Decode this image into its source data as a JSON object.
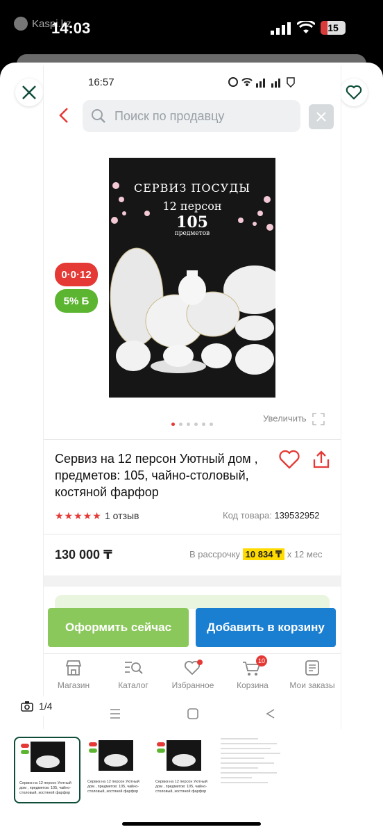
{
  "os_status": {
    "time": "14:03",
    "app_label": "Kaspi.kz",
    "battery": "15"
  },
  "viewer": {
    "counter": "1/4"
  },
  "inner_status": {
    "time": "16:57"
  },
  "header": {
    "search_placeholder": "Поиск по продавцу"
  },
  "poster": {
    "line1": "СЕРВИЗ ПОСУДЫ",
    "line2": "12 персон",
    "line3": "105",
    "line4": "предметов"
  },
  "badges": {
    "installment": "0·0·12",
    "bonus": "5% Б"
  },
  "gallery": {
    "zoom_label": "Увеличить"
  },
  "product": {
    "title": "Сервиз на 12 персон Уютный дом , предметов: 105, чайно-столовый, костяной фарфор",
    "rating": 5,
    "reviews": "1 отзыв",
    "code_label": "Код товара:",
    "code_value": "139532952",
    "price": "130 000 ₸",
    "installment_prefix": "В рассрочку",
    "installment_amount": "10 834 ₸",
    "installment_suffix": "х 12 мес"
  },
  "actions": {
    "buy_now": "Оформить сейчас",
    "add_to_cart": "Добавить в корзину"
  },
  "tabbar": {
    "items": [
      {
        "label": "Магазин",
        "icon": "shop-icon"
      },
      {
        "label": "Каталог",
        "icon": "catalog-search-icon"
      },
      {
        "label": "Избранное",
        "icon": "heart-icon"
      },
      {
        "label": "Корзина",
        "icon": "cart-icon",
        "badge": "10"
      },
      {
        "label": "Мои заказы",
        "icon": "orders-icon"
      }
    ]
  },
  "colors": {
    "accent_red": "#e53935",
    "accent_green": "#5cb531",
    "buy_now": "#8bc85b",
    "add_to_cart": "#1a7fd1",
    "highlight": "#ffdb00"
  }
}
